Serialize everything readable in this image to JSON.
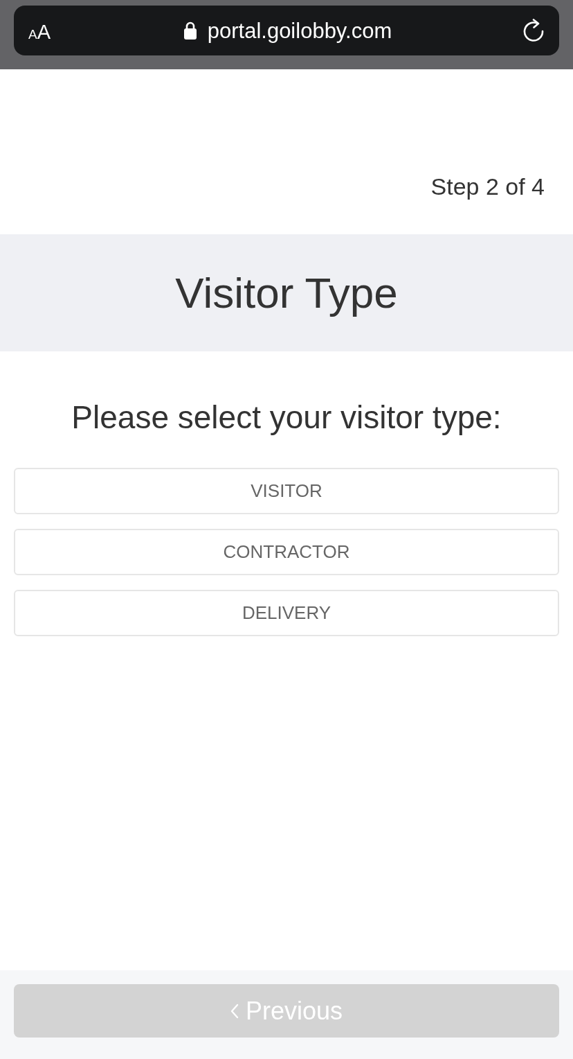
{
  "browser_bar": {
    "text_size_button": {
      "small": "A",
      "large": "A"
    },
    "url": "portal.goilobby.com",
    "secure": true
  },
  "step_indicator": "Step 2 of 4",
  "header": {
    "title": "Visitor Type"
  },
  "prompt": "Please select your visitor type:",
  "options": [
    {
      "label": "VISITOR",
      "selected": false
    },
    {
      "label": "CONTRACTOR",
      "selected": false
    },
    {
      "label": "DELIVERY",
      "selected": false
    }
  ],
  "footer": {
    "previous_button": {
      "label": "Previous",
      "disabled": true
    }
  }
}
